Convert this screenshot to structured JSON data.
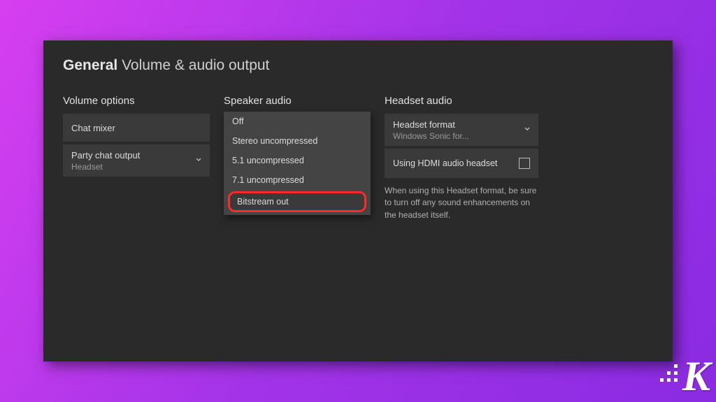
{
  "header": {
    "category": "General",
    "title": "Volume & audio output"
  },
  "volume_options": {
    "header": "Volume options",
    "chat_mixer": "Chat mixer",
    "party_chat": {
      "label": "Party chat output",
      "value": "Headset"
    }
  },
  "speaker_audio": {
    "header": "Speaker audio",
    "options": {
      "o0": "Off",
      "o1": "Stereo uncompressed",
      "o2": "5.1 uncompressed",
      "o3": "7.1 uncompressed",
      "o4": "Bitstream out"
    }
  },
  "headset_audio": {
    "header": "Headset audio",
    "format": {
      "label": "Headset format",
      "value": "Windows Sonic for..."
    },
    "hdmi": {
      "label": "Using HDMI audio headset",
      "checked": false
    },
    "hint": "When using this Headset format, be sure to turn off any sound enhancements on the headset itself."
  },
  "logo": "K"
}
